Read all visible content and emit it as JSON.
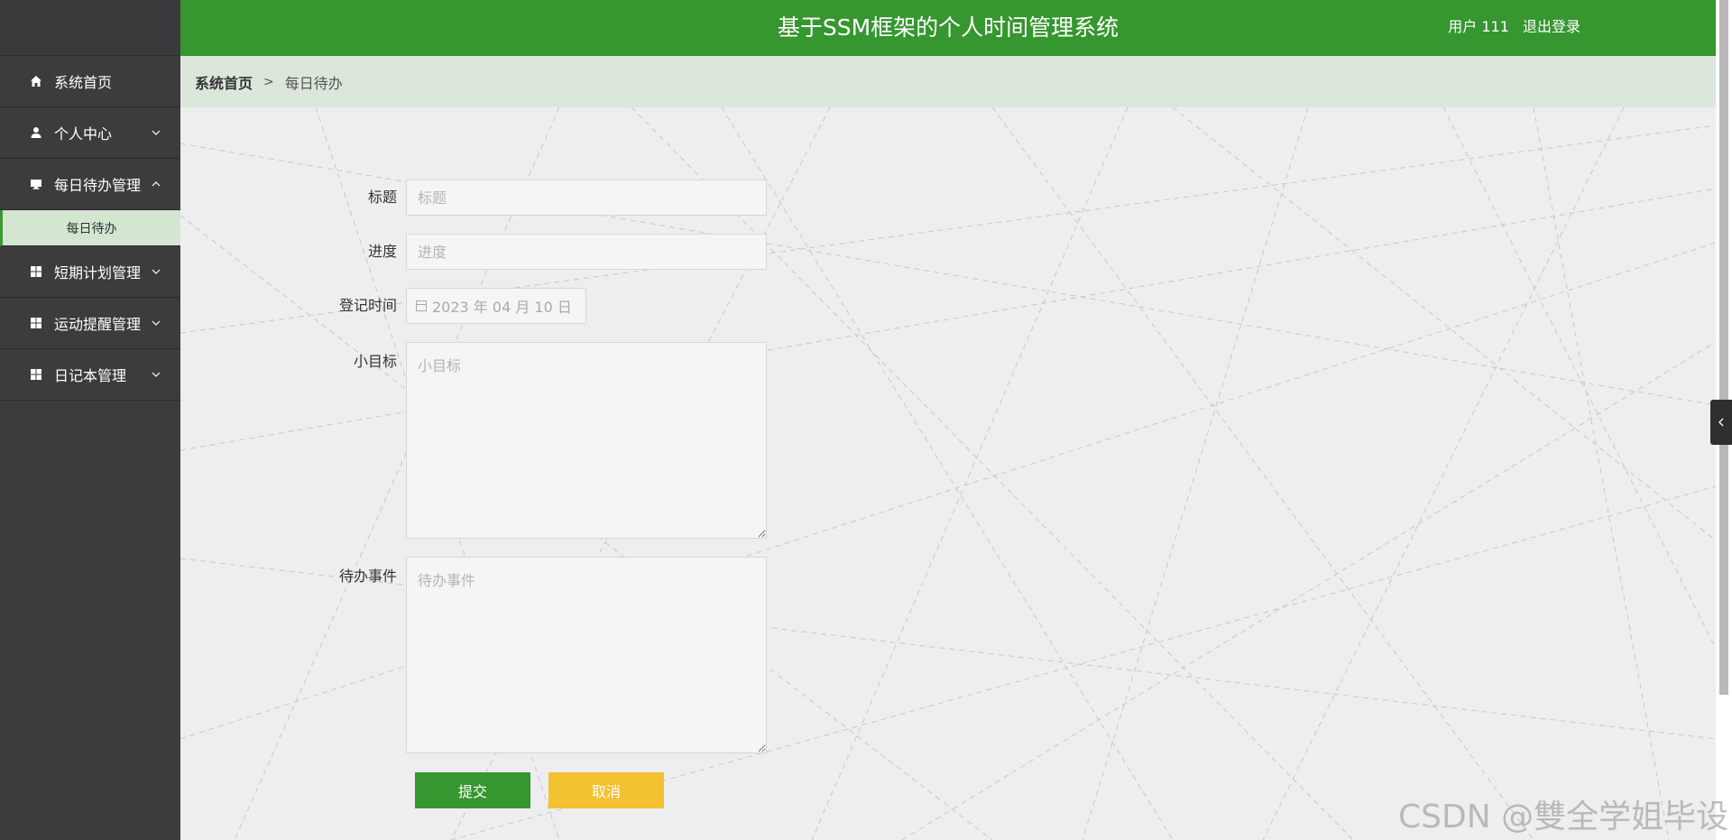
{
  "header": {
    "title": "基于SSM框架的个人时间管理系统",
    "user_label": "用户 111",
    "logout": "退出登录"
  },
  "sidebar": {
    "items": [
      {
        "label": "系统首页",
        "icon": "home-icon"
      },
      {
        "label": "个人中心",
        "icon": "user-icon"
      },
      {
        "label": "每日待办管理",
        "icon": "monitor-icon"
      },
      {
        "label": "短期计划管理",
        "icon": "grid-icon"
      },
      {
        "label": "运动提醒管理",
        "icon": "grid-icon"
      },
      {
        "label": "日记本管理",
        "icon": "grid-icon"
      }
    ],
    "sub_item": "每日待办"
  },
  "breadcrumb": {
    "home": "系统首页",
    "separator": ">",
    "current": "每日待办"
  },
  "form": {
    "title": {
      "label": "标题",
      "placeholder": "标题"
    },
    "progress": {
      "label": "进度",
      "placeholder": "进度"
    },
    "date": {
      "label": "登记时间",
      "value": "2023 年 04 月 10 日"
    },
    "goal": {
      "label": "小目标",
      "placeholder": "小目标"
    },
    "todo": {
      "label": "待办事件",
      "placeholder": "待办事件"
    },
    "submit": "提交",
    "cancel": "取消"
  },
  "watermark": "CSDN @雙全学姐毕设",
  "colors": {
    "header_green": "#36962f",
    "sidebar_dark": "#3d3b3d",
    "cancel_yellow": "#f3c131"
  }
}
